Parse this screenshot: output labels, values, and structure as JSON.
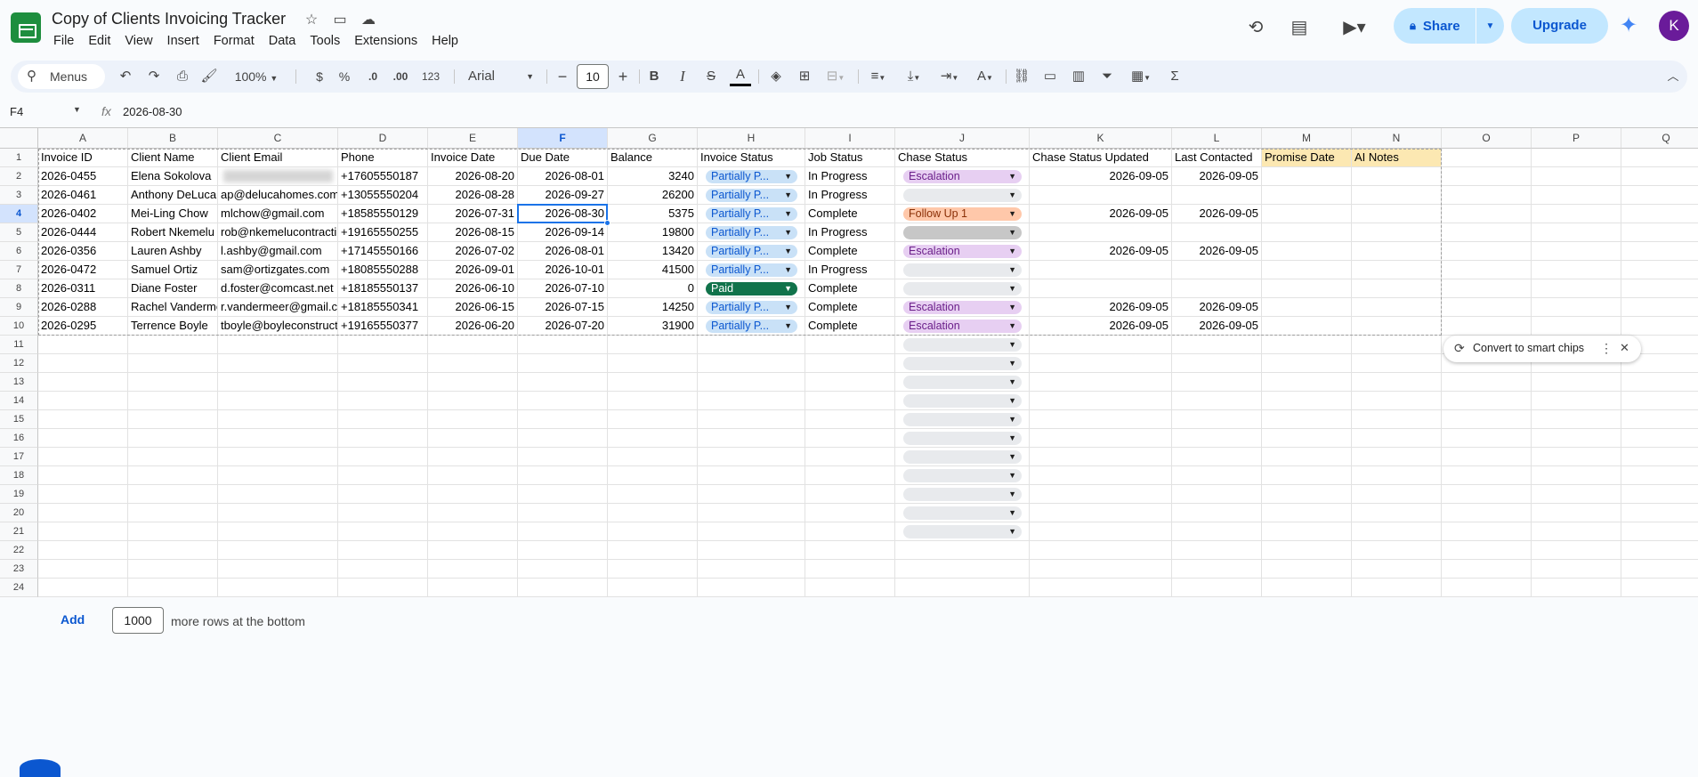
{
  "app": {
    "doc_title": "Copy of Clients Invoicing Tracker",
    "menus": [
      "File",
      "Edit",
      "View",
      "Insert",
      "Format",
      "Data",
      "Tools",
      "Extensions",
      "Help"
    ],
    "share_label": "Share",
    "upgrade_label": "Upgrade",
    "avatar_initial": "K"
  },
  "toolbar": {
    "search_label": "Menus",
    "zoom": "100%",
    "currency": "$",
    "percent": "%",
    "decrease_decimal": ".0",
    "increase_decimal": ".00",
    "number_format": "123",
    "font_name": "Arial",
    "font_size": "10"
  },
  "formula_bar": {
    "cell_ref": "F4",
    "fx_label": "fx",
    "value": "2026-08-30"
  },
  "columns": [
    "A",
    "B",
    "C",
    "D",
    "E",
    "F",
    "G",
    "H",
    "I",
    "J",
    "K",
    "L",
    "M",
    "N",
    "O",
    "P",
    "Q"
  ],
  "row_numbers": [
    "1",
    "2",
    "3",
    "4",
    "5",
    "6",
    "7",
    "8",
    "9",
    "10",
    "11",
    "12",
    "13",
    "14",
    "15",
    "16",
    "17",
    "18",
    "19",
    "20",
    "21",
    "22",
    "23",
    "24"
  ],
  "headers": [
    "Invoice ID",
    "Client Name",
    "Client Email",
    "Phone",
    "Invoice Date",
    "Due Date",
    "Balance",
    "Invoice Status",
    "Job Status",
    "Chase Status",
    "Chase Status Updated",
    "Last Contacted",
    "Promise Date",
    "AI Notes"
  ],
  "rows": [
    {
      "id": "2026-0455",
      "name": "Elena Sokolova",
      "email": "",
      "phone": "+17605550187",
      "inv_date": "2026-08-20",
      "due": "2026-08-01",
      "balance": "3240",
      "inv_status": "Partially P...",
      "job": "In Progress",
      "chase": "Escalation",
      "chase_updated": "2026-09-05",
      "last_contacted": "2026-09-05"
    },
    {
      "id": "2026-0461",
      "name": "Anthony DeLuca",
      "email": "ap@delucahomes.com",
      "phone": "+13055550204",
      "inv_date": "2026-08-28",
      "due": "2026-09-27",
      "balance": "26200",
      "inv_status": "Partially P...",
      "job": "In Progress",
      "chase": "",
      "chase_updated": "",
      "last_contacted": ""
    },
    {
      "id": "2026-0402",
      "name": "Mei-Ling Chow",
      "email": "mlchow@gmail.com",
      "phone": "+18585550129",
      "inv_date": "2026-07-31",
      "due": "2026-08-30",
      "balance": "5375",
      "inv_status": "Partially P...",
      "job": "Complete",
      "chase": "Follow Up 1",
      "chase_updated": "2026-09-05",
      "last_contacted": "2026-09-05"
    },
    {
      "id": "2026-0444",
      "name": "Robert Nkemelu",
      "email": "rob@nkemelucontracting.com",
      "phone": "+19165550255",
      "inv_date": "2026-08-15",
      "due": "2026-09-14",
      "balance": "19800",
      "inv_status": "Partially P...",
      "job": "In Progress",
      "chase": "",
      "chase_updated": "",
      "last_contacted": ""
    },
    {
      "id": "2026-0356",
      "name": "Lauren Ashby",
      "email": "l.ashby@gmail.com",
      "phone": "+17145550166",
      "inv_date": "2026-07-02",
      "due": "2026-08-01",
      "balance": "13420",
      "inv_status": "Partially P...",
      "job": "Complete",
      "chase": "Escalation",
      "chase_updated": "2026-09-05",
      "last_contacted": "2026-09-05"
    },
    {
      "id": "2026-0472",
      "name": "Samuel Ortiz",
      "email": "sam@ortizgates.com",
      "phone": "+18085550288",
      "inv_date": "2026-09-01",
      "due": "2026-10-01",
      "balance": "41500",
      "inv_status": "Partially P...",
      "job": "In Progress",
      "chase": "",
      "chase_updated": "",
      "last_contacted": ""
    },
    {
      "id": "2026-0311",
      "name": "Diane Foster",
      "email": "d.foster@comcast.net",
      "phone": "+18185550137",
      "inv_date": "2026-06-10",
      "due": "2026-07-10",
      "balance": "0",
      "inv_status": "Paid",
      "job": "Complete",
      "chase": "",
      "chase_updated": "",
      "last_contacted": ""
    },
    {
      "id": "2026-0288",
      "name": "Rachel Vandermeer",
      "email": "r.vandermeer@gmail.com",
      "phone": "+18185550341",
      "inv_date": "2026-06-15",
      "due": "2026-07-15",
      "balance": "14250",
      "inv_status": "Partially P...",
      "job": "Complete",
      "chase": "Escalation",
      "chase_updated": "2026-09-05",
      "last_contacted": "2026-09-05"
    },
    {
      "id": "2026-0295",
      "name": "Terrence Boyle",
      "email": "tboyle@boyleconstruction.com",
      "phone": "+19165550377",
      "inv_date": "2026-06-20",
      "due": "2026-07-20",
      "balance": "31900",
      "inv_status": "Partially P...",
      "job": "Complete",
      "chase": "Escalation",
      "chase_updated": "2026-09-05",
      "last_contacted": "2026-09-05"
    }
  ],
  "smart_chips": {
    "label": "Convert to smart chips"
  },
  "add_rows": {
    "button": "Add",
    "count": "1000",
    "suffix": "more rows at the bottom"
  },
  "colors": {
    "partially_paid": "#c9e1f7",
    "paid": "#11734b",
    "escalation": "#e7cff2",
    "follow_up": "#ffc8aa",
    "header_yellow": "#fce8b2",
    "selection": "#1a73e8"
  }
}
